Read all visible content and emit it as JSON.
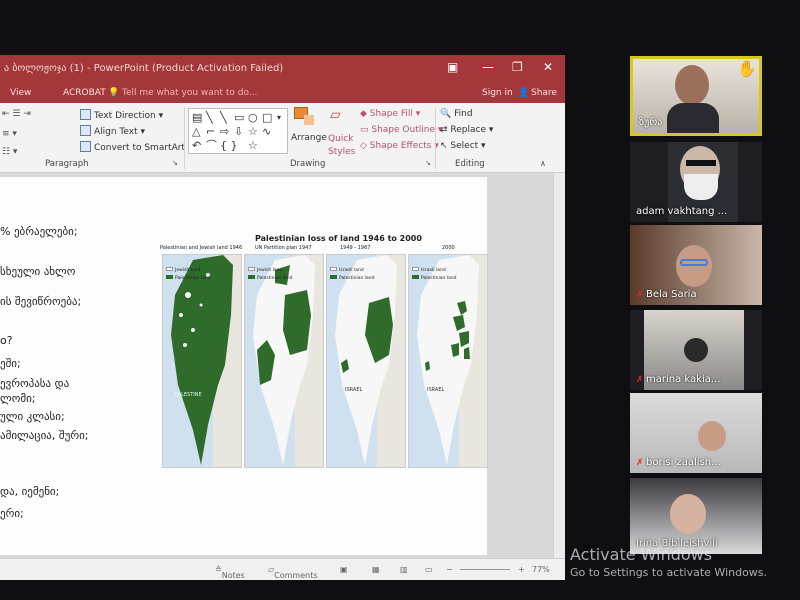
{
  "window": {
    "title": "ა ბოლოჟოჯა (1) - PowerPoint (Product Activation Failed)",
    "controls": [
      "▣",
      "—",
      "❐",
      "✕"
    ]
  },
  "ribbon_tabs": {
    "view": "View",
    "acrobat": "ACROBAT",
    "tell_me": "Tell me what you want to do...",
    "sign_in": "Sign in",
    "share": "Share"
  },
  "ribbon": {
    "text_direction": "Text Direction",
    "align_text": "Align Text",
    "convert_smartart": "Convert to SmartArt",
    "paragraph_label": "Paragraph",
    "arrange": "Arrange",
    "quick_styles": "Quick Styles",
    "shape_fill": "Shape Fill",
    "shape_outline": "Shape Outline",
    "shape_effects": "Shape Effects",
    "drawing_label": "Drawing",
    "find": "Find",
    "replace": "Replace",
    "select": "Select",
    "editing_label": "Editing"
  },
  "slide": {
    "bullets": [
      "% ებრაელები;",
      "სხეული ახლო",
      "ის შევიწროება;",
      "o?",
      "ეში;",
      "ევროპასა და",
      "ლომი;",
      "ული კლასი;",
      "ამილაცია, შური;",
      "და, იემენი;",
      "ერი;"
    ],
    "figure": {
      "title": "Palestinian loss of land 1946 to 2000",
      "panels": [
        {
          "label": "Palestinian and Jewish land 1946",
          "legend": [
            "Jewish land",
            "Palestinian land"
          ],
          "region_label": "PALESTINE"
        },
        {
          "label": "UN Partition plan 1947",
          "legend": [
            "Jewish land",
            "Palestinian land"
          ],
          "region_label": ""
        },
        {
          "label": "1949 - 1967",
          "legend": [
            "Israeli land",
            "Palestinian land"
          ],
          "region_label": "ISRAEL"
        },
        {
          "label": "2000",
          "legend": [
            "Israeli land",
            "Palestinian land"
          ],
          "region_label": "ISRAEL"
        }
      ]
    }
  },
  "statusbar": {
    "notes": "Notes",
    "comments": "Comments",
    "zoom": "77%"
  },
  "participants": [
    {
      "name": "ზურა",
      "muted": false,
      "active": true,
      "hand_raised": true
    },
    {
      "name": "adam vakhtang ...",
      "muted": false,
      "active": false,
      "hand_raised": false
    },
    {
      "name": "Bela Saria",
      "muted": true,
      "active": false,
      "hand_raised": false
    },
    {
      "name": "marina kakia...",
      "muted": true,
      "active": false,
      "hand_raised": false
    },
    {
      "name": "borisi zaalish...",
      "muted": true,
      "active": false,
      "hand_raised": false
    },
    {
      "name": "Irina Bibileishvili",
      "muted": false,
      "active": false,
      "hand_raised": false
    }
  ],
  "watermark": {
    "line1": "Activate Windows",
    "line2": "Go to Settings to activate Windows."
  },
  "colors": {
    "ppt_accent": "#a4373a",
    "palestinian_land": "#2f6b2a",
    "jewish_land": "#f7f7f7",
    "sea": "#cfe0ee",
    "active_speaker": "#d6c81e"
  }
}
